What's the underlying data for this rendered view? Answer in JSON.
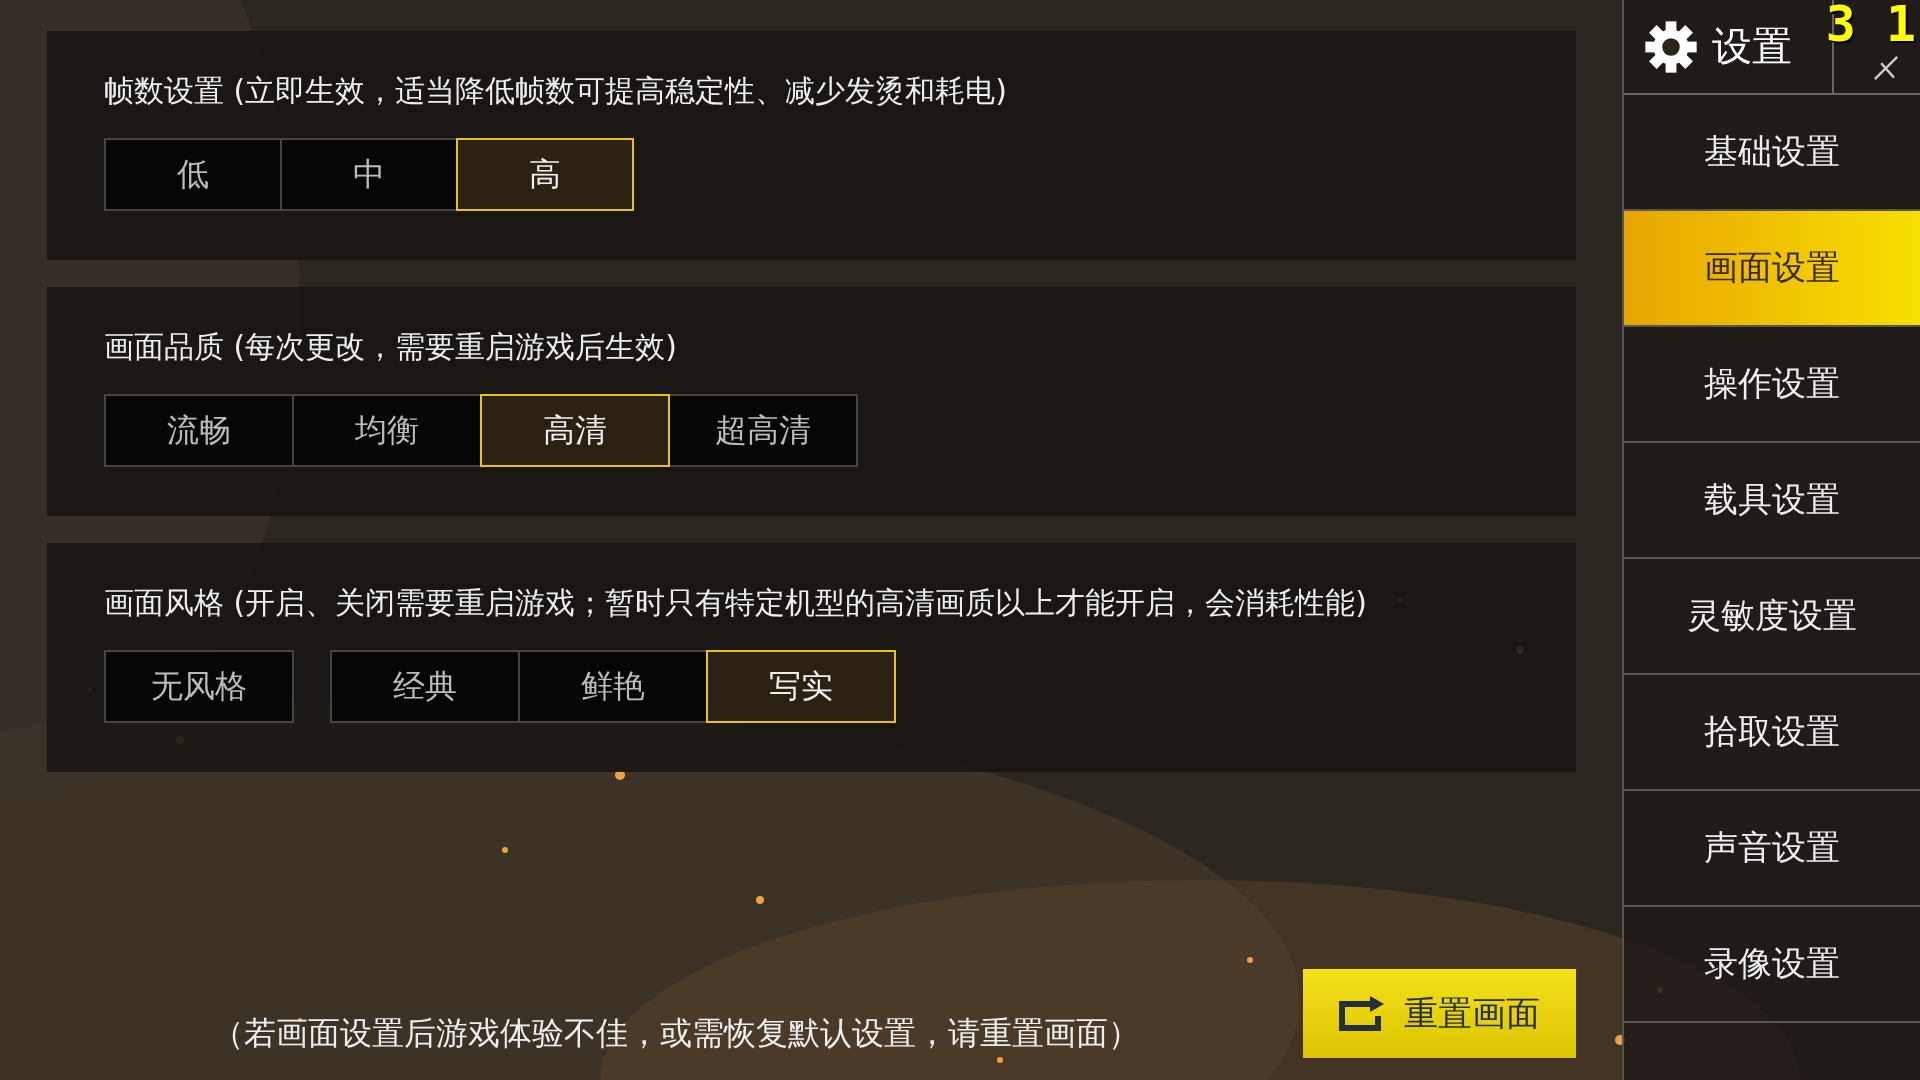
{
  "sections": [
    {
      "title": "帧数设置 (立即生效，适当降低帧数可提高稳定性、减少发烫和耗电)",
      "groups": [
        [
          {
            "label": "低",
            "selected": false
          },
          {
            "label": "中",
            "selected": false
          },
          {
            "label": "高",
            "selected": true
          }
        ]
      ]
    },
    {
      "title": "画面品质 (每次更改，需要重启游戏后生效)",
      "groups": [
        [
          {
            "label": "流畅",
            "selected": false
          },
          {
            "label": "均衡",
            "selected": false
          },
          {
            "label": "高清",
            "selected": true
          },
          {
            "label": "超高清",
            "selected": false
          }
        ]
      ]
    },
    {
      "title": "画面风格 (开启、关闭需要重启游戏；暂时只有特定机型的高清画质以上才能开启，会消耗性能)",
      "groups": [
        [
          {
            "label": "无风格",
            "selected": false
          }
        ],
        [
          {
            "label": "经典",
            "selected": false
          },
          {
            "label": "鲜艳",
            "selected": false
          },
          {
            "label": "写实",
            "selected": true
          }
        ]
      ]
    }
  ],
  "footer_note": "（若画面设置后游戏体验不佳，或需恢复默认设置，请重置画面）",
  "reset_button": {
    "label": "重置画面"
  },
  "sidebar": {
    "title": "设置",
    "items": [
      {
        "label": "基础设置",
        "selected": false
      },
      {
        "label": "画面设置",
        "selected": true
      },
      {
        "label": "操作设置",
        "selected": false
      },
      {
        "label": "载具设置",
        "selected": false
      },
      {
        "label": "灵敏度设置",
        "selected": false
      },
      {
        "label": "拾取设置",
        "selected": false
      },
      {
        "label": "声音设置",
        "selected": false
      },
      {
        "label": "录像设置",
        "selected": false
      }
    ]
  },
  "overlay_counter": [
    "3",
    "1"
  ]
}
